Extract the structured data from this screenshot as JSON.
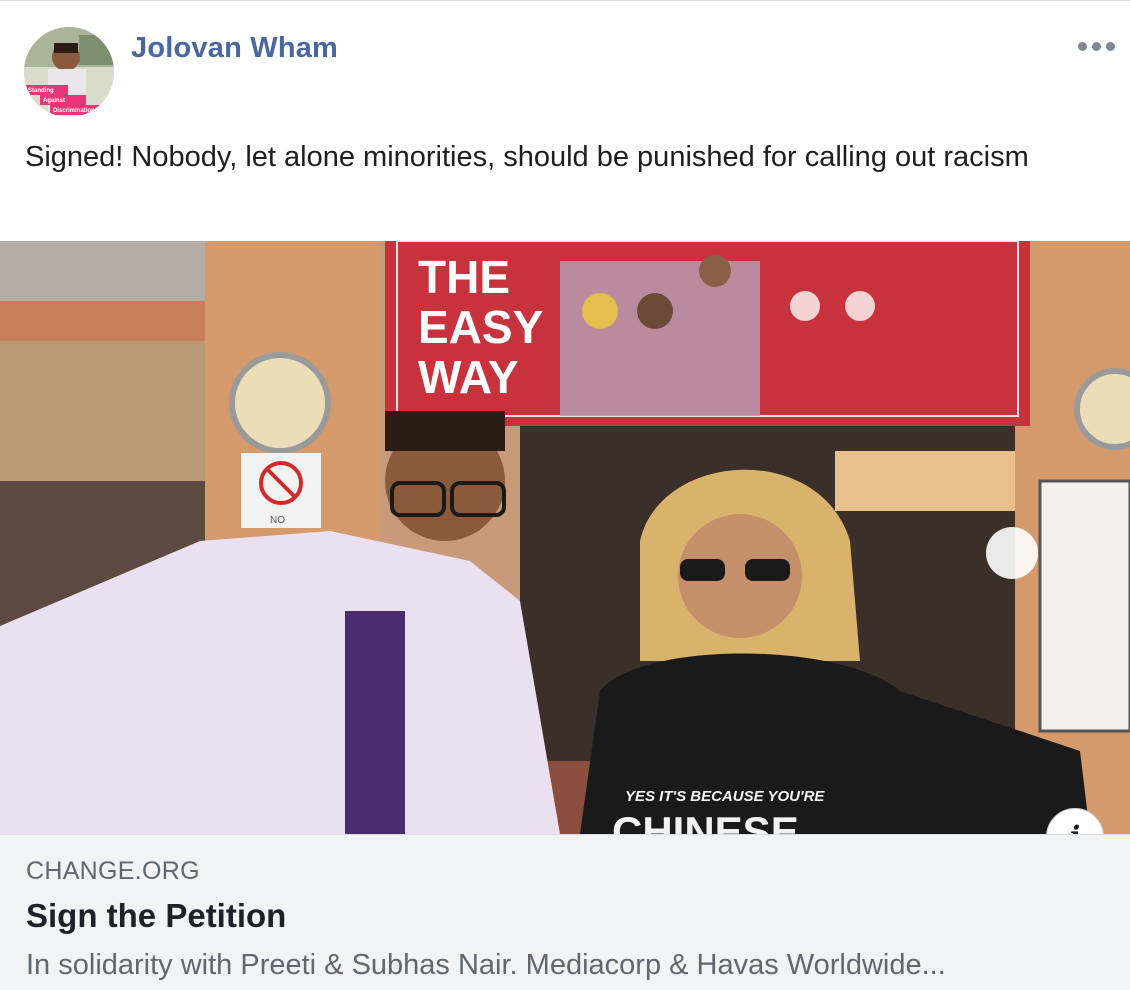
{
  "post": {
    "author": "Jolovan Wham",
    "meta": "",
    "avatar_caption": [
      "Standing",
      "Against",
      "Discrimination"
    ],
    "text": "Signed! Nobody, let alone minorities, should be punished for calling out racism"
  },
  "media": {
    "billboard_text": [
      "THE",
      "EASY",
      "WAY"
    ],
    "sign_text": "NO",
    "shirt_line1": "YES IT'S BECAUSE YOU'RE",
    "shirt_line2": "CHINESE"
  },
  "link": {
    "domain": "CHANGE.ORG",
    "title": "Sign the Petition",
    "description": "In solidarity with Preeti & Subhas Nair. Mediacorp & Havas Worldwide..."
  },
  "icons": {
    "more": "more-horizontal-icon",
    "info": "info-icon"
  },
  "colors": {
    "author_link": "#4b67a1",
    "link_background": "#f2f3f5",
    "billboard_red": "#c8323c"
  }
}
